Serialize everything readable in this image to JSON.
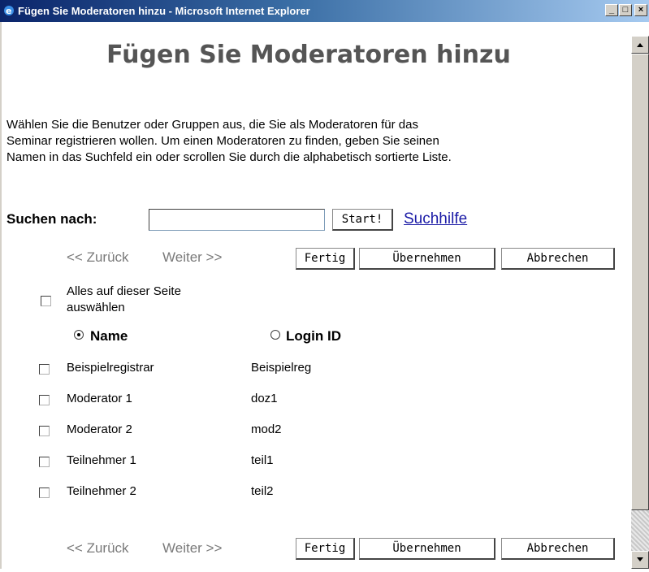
{
  "window": {
    "title": "Fügen Sie Moderatoren hinzu - Microsoft Internet Explorer",
    "minimize": "_",
    "maximize": "□",
    "close": "×"
  },
  "page": {
    "heading": "Fügen Sie Moderatoren hinzu",
    "intro_lines": [
      "Wählen Sie die Benutzer oder Gruppen aus, die Sie als Moderatoren für das",
      "Seminar registrieren wollen. Um einen Moderatoren zu finden, geben Sie seinen",
      "Namen in das Suchfeld ein oder scrollen Sie durch die alphabetisch sortierte Liste."
    ]
  },
  "search": {
    "label": "Suchen nach:",
    "value": "",
    "start_label": "Start!",
    "help_label": "Suchhilfe"
  },
  "nav": {
    "back": "<< Zurück",
    "next": "Weiter >>"
  },
  "actions": {
    "done": "Fertig",
    "apply": "Übernehmen",
    "cancel": "Abbrechen"
  },
  "select_all": {
    "line1": "Alles auf dieser Seite",
    "line2": "auswählen"
  },
  "columns": {
    "name": "Name",
    "login": "Login ID",
    "sort_by": "name"
  },
  "rows": [
    {
      "name": "Beispielregistrar",
      "login": "Beispielreg"
    },
    {
      "name": "Moderator 1",
      "login": "doz1"
    },
    {
      "name": "Moderator 2",
      "login": "mod2"
    },
    {
      "name": "Teilnehmer 1",
      "login": "teil1"
    },
    {
      "name": "Teilnehmer 2",
      "login": "teil2"
    }
  ]
}
